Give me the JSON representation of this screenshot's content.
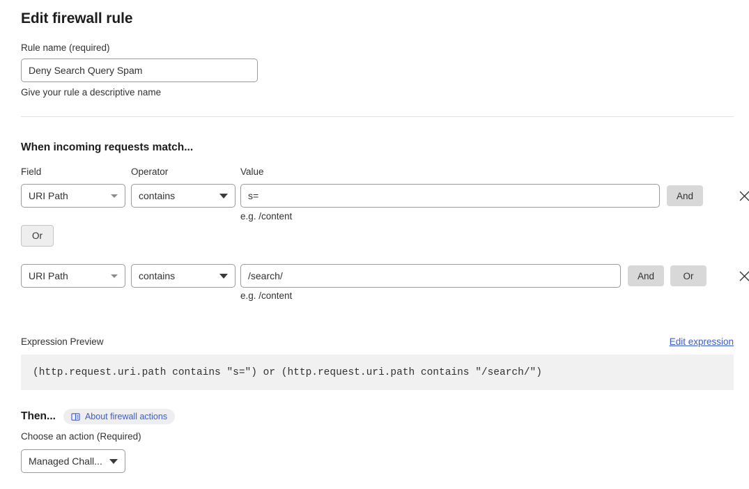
{
  "page_title": "Edit firewall rule",
  "rule_name": {
    "label": "Rule name (required)",
    "value": "Deny Search Query Spam",
    "placeholder": "",
    "help": "Give your rule a descriptive name"
  },
  "match_section": {
    "heading": "When incoming requests match...",
    "columns": {
      "field": "Field",
      "operator": "Operator",
      "value": "Value"
    },
    "or_between_label": "Or",
    "rows": [
      {
        "field": "URI Path",
        "operator": "contains",
        "value": "s=",
        "value_help": "e.g. /content",
        "and_label": "And",
        "close_label": "Remove condition"
      },
      {
        "field": "URI Path",
        "operator": "contains",
        "value": "/search/",
        "value_help": "e.g. /content",
        "and_label": "And",
        "or_label": "Or",
        "close_label": "Remove condition"
      }
    ]
  },
  "expression": {
    "label": "Expression Preview",
    "edit_link": "Edit expression",
    "text": "(http.request.uri.path contains \"s=\") or (http.request.uri.path contains \"/search/\")"
  },
  "then_section": {
    "heading": "Then...",
    "badge_label": "About firewall actions",
    "badge_icon": "book-icon",
    "action_label": "Choose an action (Required)",
    "action_value": "Managed Chall..."
  },
  "colors": {
    "link": "#3b5ccc",
    "badge_bg": "#eeeef1",
    "logic_btn_bg": "#d8d8d8",
    "expr_bg": "#f1f1f1",
    "border": "#999999",
    "divider": "#e2e2e2"
  }
}
